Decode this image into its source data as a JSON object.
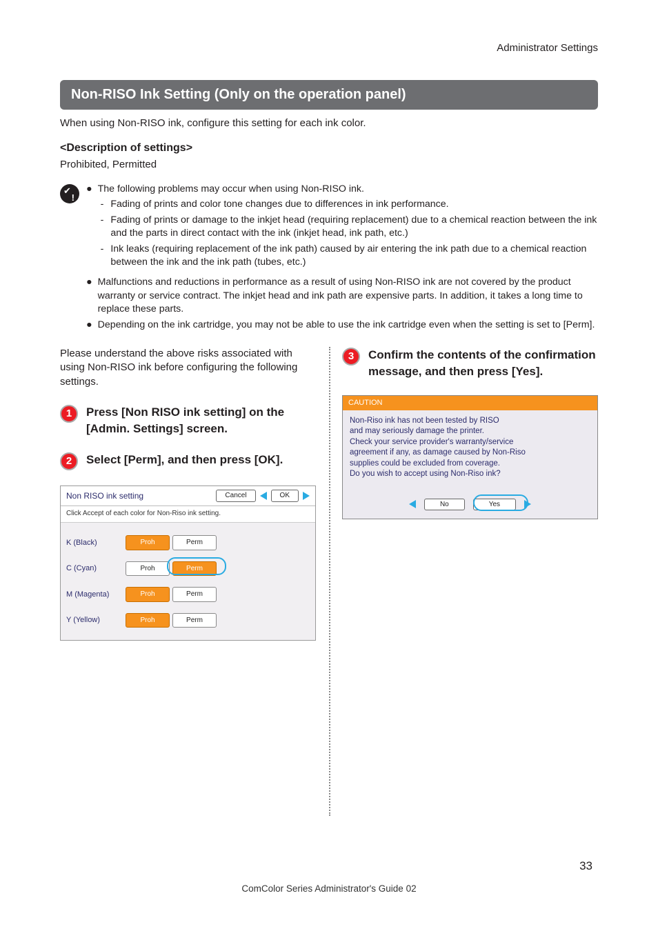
{
  "header": "Administrator Settings",
  "title": "Non-RISO Ink Setting (Only on the operation panel)",
  "intro": "When using Non-RISO ink, configure this setting for each ink color.",
  "desc_heading": "<Description of settings>",
  "desc_values": "Prohibited, Permitted",
  "caution": {
    "b1": "The following problems may occur when using Non-RISO ink.",
    "s1": "Fading of prints and color tone changes due to differences in ink performance.",
    "s2": "Fading of prints or damage to the inkjet head (requiring replacement) due to a chemical reaction between the ink and the parts in direct contact with the ink (inkjet head, ink path, etc.)",
    "s3": "Ink leaks (requiring replacement of the ink path) caused by air entering the ink path due to a chemical reaction between the ink and the ink path (tubes, etc.)",
    "b2": "Malfunctions and reductions in performance as a result of using Non-RISO ink are not covered by the product warranty or service contract. The inkjet head and ink path are expensive parts. In addition, it takes a long time to replace these parts.",
    "b3": "Depending on the ink cartridge, you may not be able to use the ink cartridge even when the setting is set to [Perm]."
  },
  "lead": "Please understand the above risks associated with using Non-RISO ink before configuring the following settings.",
  "steps": {
    "n1": "1",
    "t1": "Press [Non RISO ink setting] on the [Admin. Settings] screen.",
    "n2": "2",
    "t2": "Select [Perm], and then press [OK].",
    "n3": "3",
    "t3": "Confirm the contents of the confirmation message, and then press [Yes]."
  },
  "panel1": {
    "title": "Non RISO ink setting",
    "cancel": "Cancel",
    "ok": "OK",
    "sub": "Click Accept of each color for Non-Riso ink setting.",
    "rows": [
      {
        "label": "K (Black)",
        "proh": "Proh",
        "perm": "Perm",
        "sel": "proh"
      },
      {
        "label": "C (Cyan)",
        "proh": "Proh",
        "perm": "Perm",
        "sel": "perm"
      },
      {
        "label": "M (Magenta)",
        "proh": "Proh",
        "perm": "Perm",
        "sel": "proh"
      },
      {
        "label": "Y (Yellow)",
        "proh": "Proh",
        "perm": "Perm",
        "sel": "proh"
      }
    ]
  },
  "panel2": {
    "title": "CAUTION",
    "l1": "Non-Riso ink has not been tested by RISO",
    "l2": "and may seriously damage the printer.",
    "l3": "Check your service provider's warranty/service",
    "l4": "agreement if any, as damage caused by Non-Riso",
    "l5": "supplies could be excluded from coverage.",
    "l6": "Do you wish to accept using Non-Riso ink?",
    "no": "No",
    "yes": "Yes"
  },
  "page_number": "33",
  "footer": "ComColor Series  Administrator's Guide  02"
}
